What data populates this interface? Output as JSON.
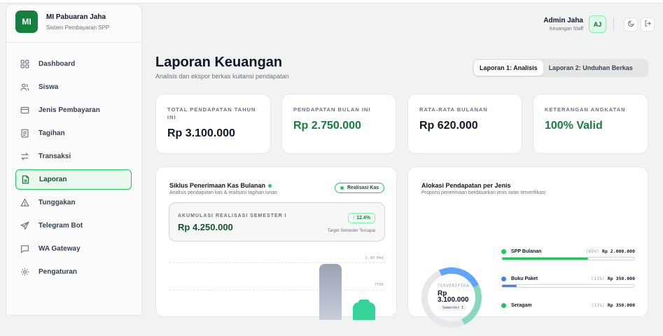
{
  "brand": {
    "logo": "MI",
    "name": "MI Pabuaran Jaha",
    "subtitle": "Sistem Pembayaran SPP"
  },
  "sidebar": {
    "items": [
      {
        "label": "Dashboard",
        "icon": "grid-icon",
        "active": false
      },
      {
        "label": "Siswa",
        "icon": "users-icon",
        "active": false
      },
      {
        "label": "Jenis Pembayaran",
        "icon": "card-icon",
        "active": false
      },
      {
        "label": "Tagihan",
        "icon": "receipt-icon",
        "active": false
      },
      {
        "label": "Transaksi",
        "icon": "swap-icon",
        "active": false
      },
      {
        "label": "Laporan",
        "icon": "file-report-icon",
        "active": true
      },
      {
        "label": "Tunggakan",
        "icon": "warning-icon",
        "active": false
      },
      {
        "label": "Telegram Bot",
        "icon": "send-icon",
        "active": false
      },
      {
        "label": "WA Gateway",
        "icon": "chat-icon",
        "active": false
      },
      {
        "label": "Pengaturan",
        "icon": "gear-icon",
        "active": false
      }
    ]
  },
  "header": {
    "user_name": "Admin Jaha",
    "user_role": "Keuangan Staff",
    "avatar": "AJ",
    "icons": [
      "moon-icon",
      "logout-icon"
    ]
  },
  "page": {
    "title": "Laporan Keuangan",
    "subtitle": "Analisis dan ekspor berkas kuitansi pendapatan",
    "tabs": [
      {
        "label": "Laporan 1: Analisis",
        "active": true
      },
      {
        "label": "Laporan 2: Unduhan Berkas",
        "active": false
      }
    ]
  },
  "stats": [
    {
      "label": "TOTAL PENDAPATAN TAHUN INI",
      "value": "Rp 3.100.000",
      "accent": false
    },
    {
      "label": "PENDAPATAN BULAN INI",
      "value": "Rp 2.750.000",
      "accent": true
    },
    {
      "label": "RATA-RATA BULANAN",
      "value": "Rp 620.000",
      "accent": false
    },
    {
      "label": "KETERANGAN ANGKATAN",
      "value": "100% Valid",
      "accent": true
    }
  ],
  "cashflow": {
    "title": "Siklus Penerimaan Kas Bulanan",
    "subtitle": "Analisis pendapatan kas & realisasi tagihan lunas",
    "pill": "Realisasi Kas",
    "accum_label": "AKUMULASI REALISASI SEMESTER I",
    "accum_value": "Rp 4.250.000",
    "growth": "↑ 12.4%",
    "target_note": "Target Semester Tercapai",
    "ticks": [
      "1.9M MAX",
      "750K"
    ]
  },
  "allocation": {
    "title": "Alokasi Pendapatan per Jenis",
    "subtitle": "Proporsi penerimaan berdasarkan jenis iuran terverifikasi",
    "ring_label": "TERVERIFIKA...",
    "ring_value": "Rp 3.100.000",
    "ring_note": "Semester I",
    "items": [
      {
        "name": "SPP Bulanan",
        "percent": "(65%)",
        "amount": "Rp 2.000.000",
        "share": 0.65,
        "color": "#22c55e"
      },
      {
        "name": "Buku Paket",
        "percent": "(11%)",
        "amount": "Rp 350.000",
        "share": 0.11,
        "color": "#3b82f6"
      },
      {
        "name": "Seragam",
        "percent": "(11%)",
        "amount": "Rp 350.000",
        "share": 0.11,
        "color": "#22c55e"
      }
    ]
  }
}
